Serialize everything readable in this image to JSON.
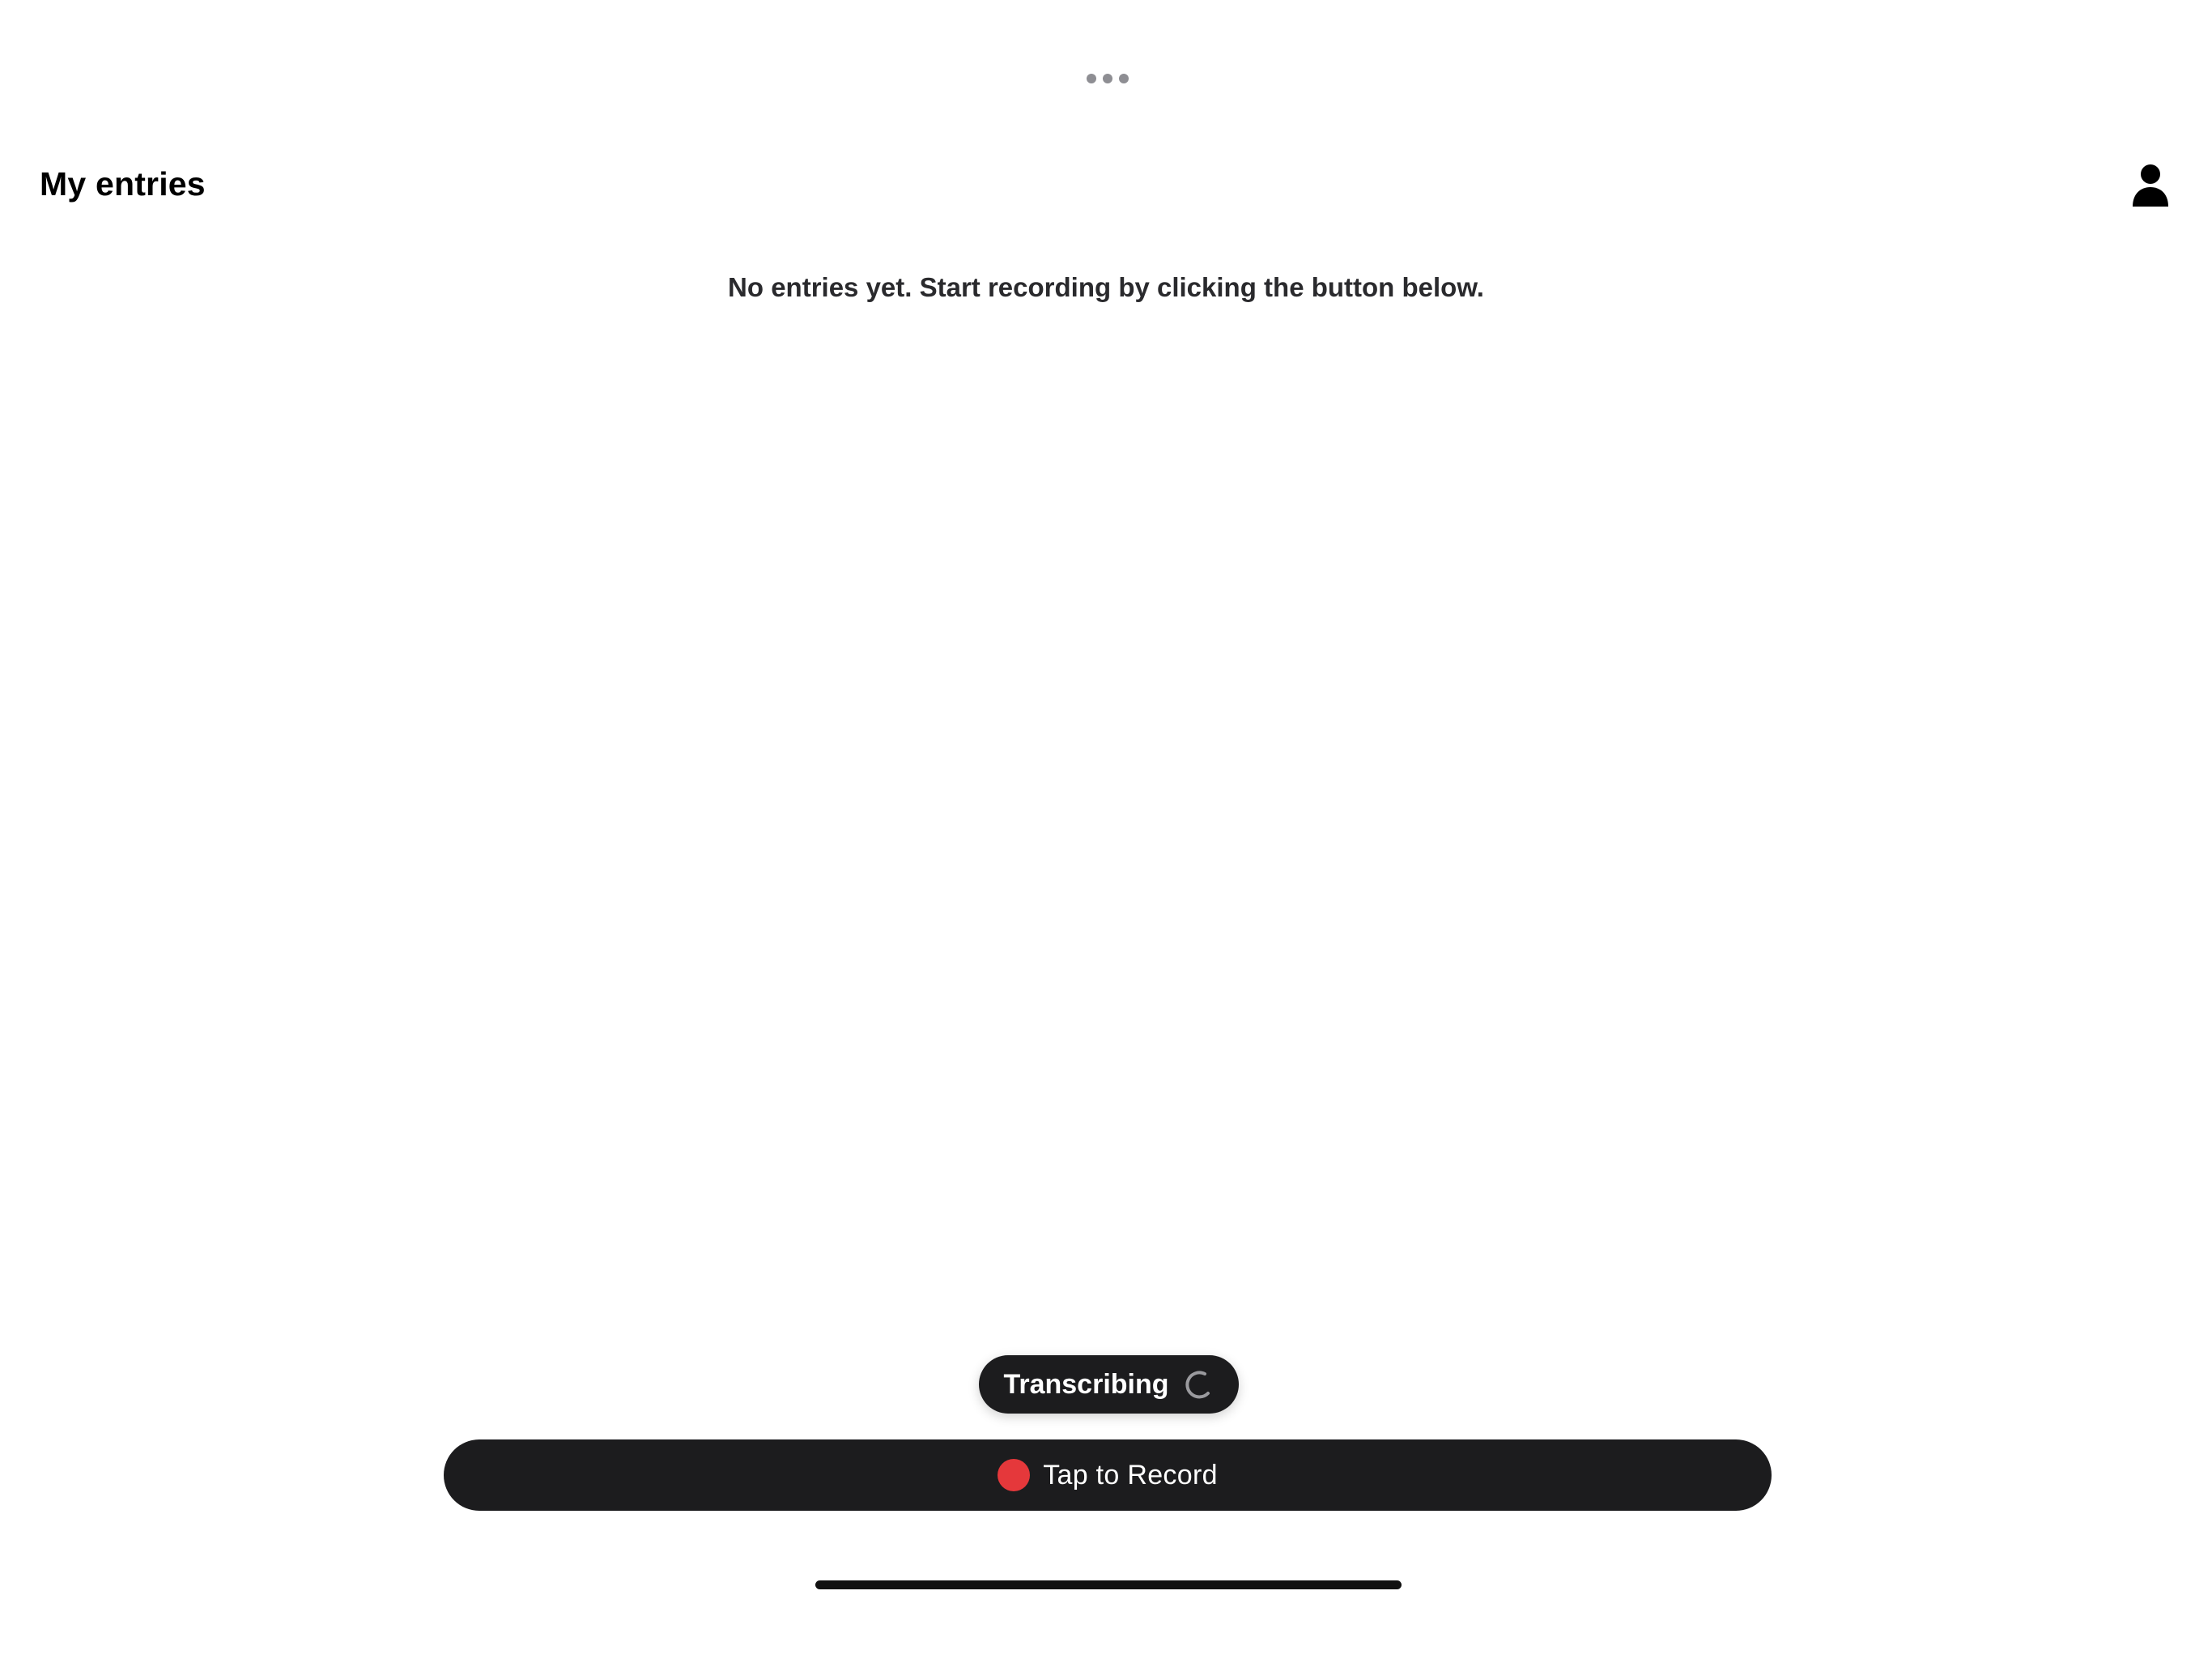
{
  "header": {
    "title": "My entries",
    "profile_icon": "person-icon"
  },
  "main": {
    "empty_message": "No entries yet. Start recording by clicking the button below."
  },
  "status": {
    "label": "Transcribing",
    "icon": "spinner-icon"
  },
  "record": {
    "label": "Tap to Record",
    "dot_color": "#e5383b"
  },
  "system": {
    "multitasking_icon": "ellipsis-icon"
  },
  "colors": {
    "button_background": "#1c1c1e",
    "record_indicator": "#e5383b",
    "text_secondary": "#2a2a2d"
  }
}
